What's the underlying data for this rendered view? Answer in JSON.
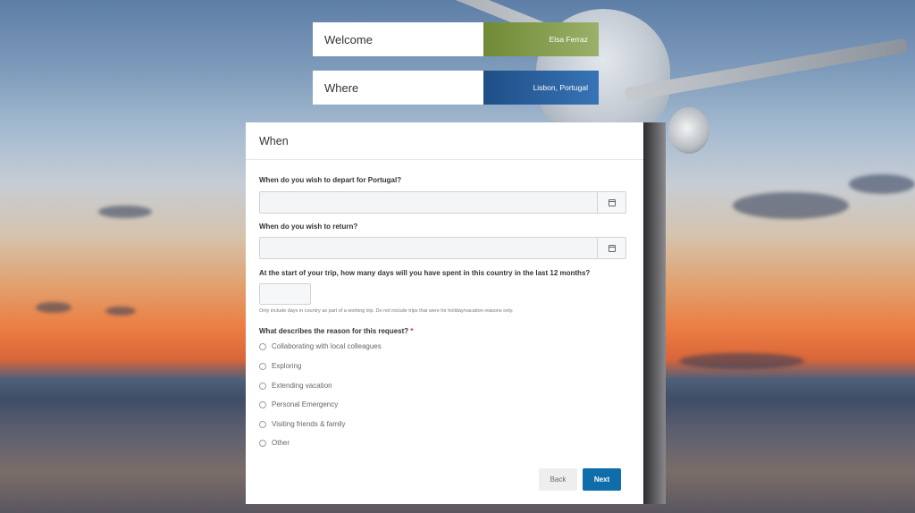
{
  "summary": {
    "welcome": {
      "label": "Welcome",
      "value": "Elsa Ferraz",
      "color": "#7f9b47"
    },
    "where": {
      "label": "Where",
      "value": "Lisbon, Portugal",
      "color": "#2a5f9c"
    }
  },
  "form": {
    "title": "When",
    "depart": {
      "label": "When do you wish to depart for Portugal?",
      "value": "",
      "icon": "calendar-icon"
    },
    "return": {
      "label": "When do you wish to return?",
      "value": "",
      "icon": "calendar-icon"
    },
    "days": {
      "label": "At the start of your trip, how many days will you have spent in this country in the last 12 months?",
      "value": "",
      "help": "Only include days in country as part of a working trip. Do not include trips that were for holiday/vacation reasons only."
    },
    "reason": {
      "label": "What describes the reason for this request?",
      "required_mark": "*",
      "options": [
        "Collaborating with local colleagues",
        "Exploring",
        "Extending vacation",
        "Personal Emergency",
        "Visiting friends & family",
        "Other"
      ]
    },
    "buttons": {
      "back": "Back",
      "next": "Next"
    },
    "accent": "#0f6ea9"
  }
}
